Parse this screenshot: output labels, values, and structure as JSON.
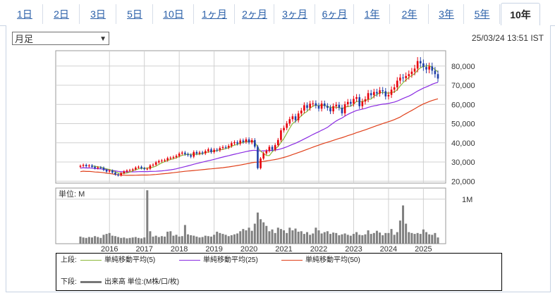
{
  "tabs": [
    {
      "label": "1日",
      "active": false
    },
    {
      "label": "2日",
      "active": false
    },
    {
      "label": "3日",
      "active": false
    },
    {
      "label": "5日",
      "active": false
    },
    {
      "label": "10日",
      "active": false
    },
    {
      "label": "1ヶ月",
      "active": false
    },
    {
      "label": "2ヶ月",
      "active": false
    },
    {
      "label": "3ヶ月",
      "active": false
    },
    {
      "label": "6ヶ月",
      "active": false
    },
    {
      "label": "1年",
      "active": false
    },
    {
      "label": "2年",
      "active": false
    },
    {
      "label": "3年",
      "active": false
    },
    {
      "label": "5年",
      "active": false
    },
    {
      "label": "10年",
      "active": true
    }
  ],
  "controls": {
    "interval_select": "月足",
    "timestamp": "25/03/24 13:51 IST"
  },
  "colors": {
    "up_candle": "#e8000b",
    "down_candle": "#1f3fa8",
    "ma5": "#8cb83a",
    "ma25": "#8a2be2",
    "ma50": "#e0401a",
    "volume": "#808080",
    "grid": "#d0d0d0",
    "link": "#2a5fa8"
  },
  "legend": {
    "upper_label": "上段:",
    "lower_label": "下段:",
    "ma5": "単純移動平均(5)",
    "ma25": "単純移動平均(25)",
    "ma50": "単純移動平均(50)",
    "volume": "出来高 単位:(M株/口/枚)"
  },
  "chart_data": [
    {
      "type": "candlestick",
      "title": "",
      "x_tick_labels": [
        "2016",
        "2017",
        "2018",
        "2019",
        "2020",
        "2021",
        "2022",
        "2023",
        "2024",
        "2025"
      ],
      "y_tick_labels": [
        "20,000",
        "30,000",
        "40,000",
        "50,000",
        "60,000",
        "70,000",
        "80,000"
      ],
      "ylim": [
        19000,
        88000
      ],
      "grid": true,
      "series": [
        {
          "name": "単純移動平均(5)",
          "kind": "line"
        },
        {
          "name": "単純移動平均(25)",
          "kind": "line"
        },
        {
          "name": "単純移動平均(50)",
          "kind": "line"
        }
      ],
      "x_start": "2015-03",
      "monthly_close": [
        28000,
        28500,
        27800,
        28200,
        27500,
        26800,
        27200,
        27000,
        25900,
        25000,
        25500,
        24500,
        23500,
        23000,
        24200,
        25100,
        25600,
        25800,
        26200,
        27100,
        27500,
        26800,
        26300,
        26500,
        28200,
        28600,
        29800,
        30500,
        30800,
        31000,
        32000,
        32200,
        32600,
        33200,
        34400,
        34900,
        34100,
        33600,
        32800,
        35200,
        34400,
        35000,
        34500,
        35700,
        36600,
        35200,
        36400,
        36100,
        37300,
        37800,
        37600,
        38400,
        39800,
        40300,
        39600,
        41200,
        40500,
        41800,
        40200,
        41400,
        38000,
        26800,
        31800,
        34500,
        35800,
        37900,
        36400,
        38800,
        41500,
        46500,
        47800,
        50100,
        52300,
        53800,
        51800,
        55300,
        56800,
        59600,
        58200,
        60400,
        60600,
        59400,
        57800,
        60500,
        59200,
        58200,
        56400,
        59100,
        59800,
        58300,
        55400,
        60100,
        61300,
        60400,
        62900,
        63800,
        59100,
        61500,
        62700,
        65900,
        64800,
        66500,
        65700,
        67400,
        66900,
        64200,
        65000,
        67700,
        68900,
        72400,
        74000,
        73700,
        74800,
        75800,
        77100,
        78700,
        82600,
        81400,
        79500,
        78200,
        79800,
        77600,
        75800,
        73500
      ],
      "ma5_start_index": 4,
      "ma25_start_index": 0,
      "ma50_start_index": 0
    },
    {
      "type": "bar",
      "title": "",
      "ylabel": "単位: M",
      "y_tick_labels": [
        "1M"
      ],
      "ylim": [
        0,
        1.25
      ],
      "grid": true,
      "series_name": "出来高",
      "volume_values": [
        0.16,
        0.14,
        0.13,
        0.15,
        0.14,
        0.17,
        0.15,
        0.13,
        0.2,
        0.22,
        0.24,
        0.18,
        0.17,
        0.15,
        0.13,
        0.14,
        0.12,
        0.13,
        0.14,
        0.15,
        0.13,
        0.12,
        0.14,
        1.2,
        0.28,
        0.16,
        0.18,
        0.15,
        0.17,
        0.16,
        0.27,
        0.28,
        0.18,
        0.2,
        0.16,
        0.17,
        0.42,
        0.21,
        0.19,
        0.18,
        0.16,
        0.14,
        0.15,
        0.18,
        0.17,
        0.16,
        0.2,
        0.27,
        0.24,
        0.22,
        0.2,
        0.17,
        0.19,
        0.21,
        0.23,
        0.28,
        0.33,
        0.3,
        0.36,
        0.29,
        0.45,
        0.7,
        0.55,
        0.48,
        0.4,
        0.28,
        0.32,
        0.24,
        0.36,
        0.33,
        0.3,
        0.24,
        0.36,
        0.3,
        0.34,
        0.27,
        0.28,
        0.22,
        0.26,
        0.2,
        0.23,
        0.36,
        0.3,
        0.23,
        0.26,
        0.28,
        0.22,
        0.25,
        0.24,
        0.19,
        0.21,
        0.23,
        0.2,
        0.18,
        0.22,
        0.26,
        0.2,
        0.19,
        0.21,
        0.3,
        0.22,
        0.24,
        0.29,
        0.25,
        0.19,
        0.24,
        0.24,
        0.33,
        0.2,
        0.26,
        0.52,
        0.86,
        0.45,
        0.26,
        0.24,
        0.22,
        0.24,
        0.22,
        0.32,
        0.26,
        0.21,
        0.2,
        0.24,
        0.14
      ]
    }
  ]
}
